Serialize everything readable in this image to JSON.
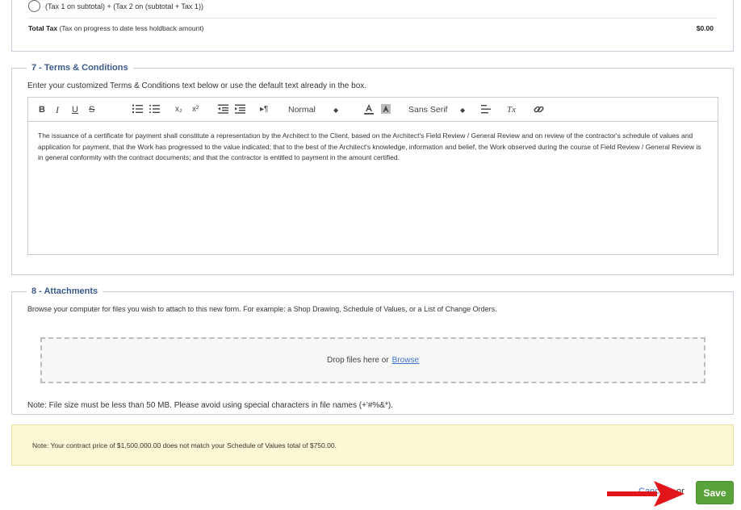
{
  "tax": {
    "option_label": "(Tax 1 on subtotal) + (Tax 2 on (subtotal + Tax 1))",
    "total_tax_label": "Total Tax",
    "total_tax_desc": "(Tax on progress to date less holdback amount)",
    "total_tax_value": "$0.00"
  },
  "terms": {
    "legend": "7 - Terms & Conditions",
    "instructions": "Enter your customized Terms & Conditions text below or use the default text already in the box.",
    "toolbar": {
      "bold": "B",
      "italic": "I",
      "underline": "U",
      "strike": "S",
      "subscript": "x₂",
      "superscript": "x²",
      "direction": "▸¶",
      "size_value": "Normal",
      "font_value": "Sans Serif",
      "clear_format": "Tx"
    },
    "body": "The issuance of a certificate for payment shall constitute a representation by the Architect to the Client, based on the Architect's Field Review / General Review and on review of the contractor's schedule of values and application for payment, that the Work has progressed to the value indicated; that to the best of the Architect's knowledge, information and belief, the Work observed during the course of Field Review / General Review is in general conformity with the contract documents; and that the contractor is entitled to payment in the amount certified."
  },
  "attachments": {
    "legend": "8 - Attachments",
    "instructions": "Browse your computer for files you wish to attach to this new form. For example: a Shop Drawing, Schedule of Values, or a List of Change Orders.",
    "drop_text": "Drop files here or",
    "browse_label": "Browse",
    "note": "Note: File size must be less than 50 MB. Please avoid using special characters in file names (+'#%&*)."
  },
  "warning": {
    "text": "Note: Your contract price of $1,500,000.00 does not match your Schedule of Values total of $750.00."
  },
  "footer": {
    "cancel_label": "Cancel",
    "or_label": "or",
    "save_label": "Save"
  },
  "colors": {
    "legend": "#3a5a8c",
    "save": "#5aa33a",
    "warning_bg": "#fcf8d5",
    "arrow": "#e0161b"
  }
}
